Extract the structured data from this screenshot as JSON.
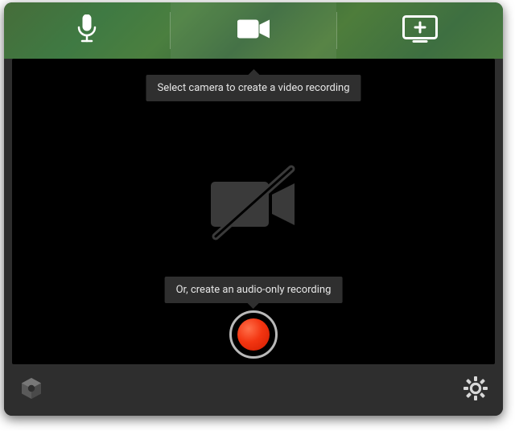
{
  "tabs": {
    "audio": {
      "icon": "microphone-icon",
      "active": false
    },
    "video": {
      "icon": "video-camera-icon",
      "active": true
    },
    "screen": {
      "icon": "screen-plus-icon",
      "active": false
    }
  },
  "tooltips": {
    "select_camera": "Select camera to create a video recording",
    "audio_only": "Or, create an audio-only recording"
  },
  "placeholder": {
    "icon": "camera-off-icon"
  },
  "controls": {
    "record": {
      "icon": "record-icon"
    }
  },
  "bottom": {
    "logo": {
      "icon": "app-logo-icon"
    },
    "settings": {
      "icon": "gear-icon"
    }
  },
  "colors": {
    "header_green": "#437a3f",
    "record_red": "#f33511",
    "background": "#2e2e2e"
  }
}
